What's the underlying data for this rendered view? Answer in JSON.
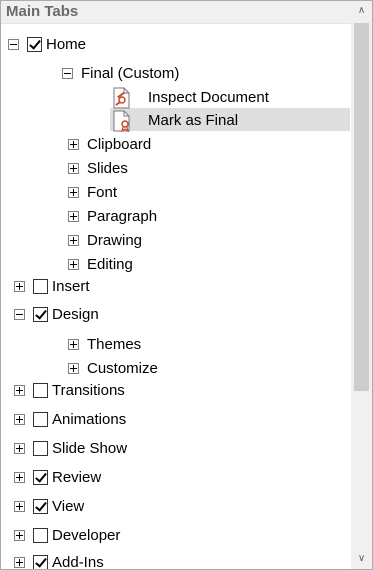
{
  "header": {
    "title": "Main Tabs"
  },
  "tree": {
    "home": "Home",
    "final_custom": "Final (Custom)",
    "inspect_document": "Inspect Document",
    "mark_as_final": "Mark as Final",
    "clipboard": "Clipboard",
    "slides": "Slides",
    "font": "Font",
    "paragraph": "Paragraph",
    "drawing": "Drawing",
    "editing": "Editing",
    "insert": "Insert",
    "design": "Design",
    "themes": "Themes",
    "customize": "Customize",
    "transitions": "Transitions",
    "animations": "Animations",
    "slide_show": "Slide Show",
    "review": "Review",
    "view": "View",
    "developer": "Developer",
    "add_ins": "Add-Ins"
  },
  "icons": {
    "inspect_document": "inspect-document-icon",
    "mark_as_final": "mark-as-final-icon",
    "scroll_up": "scroll-up-arrow-icon",
    "scroll_down": "scroll-down-arrow-icon"
  },
  "colors": {
    "accent_red": "#d24726",
    "selection": "#dedede",
    "header": "#f0f0f0"
  }
}
